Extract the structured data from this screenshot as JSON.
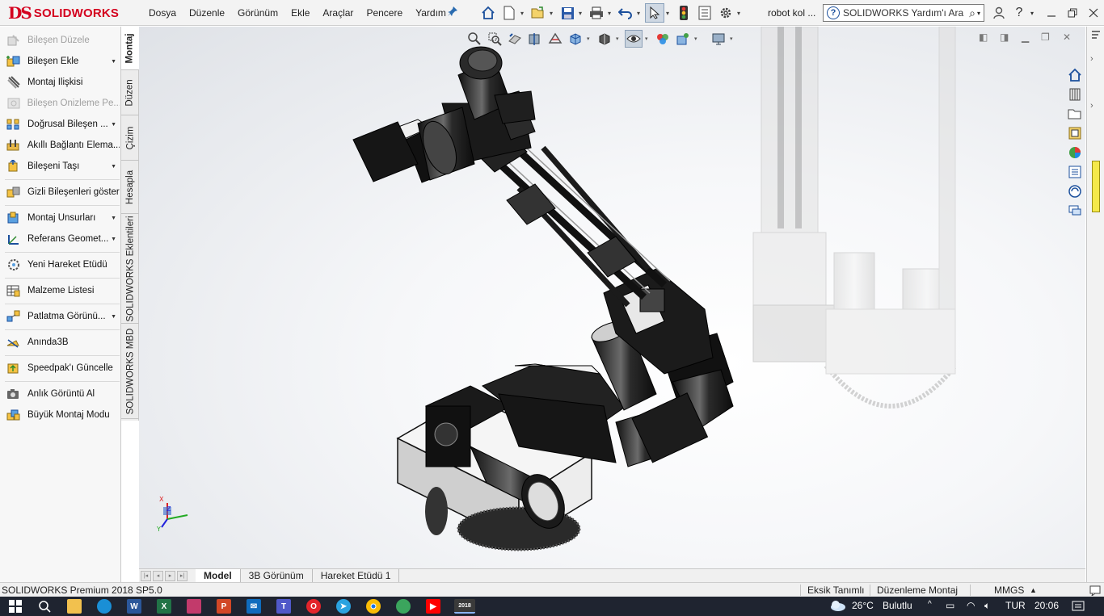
{
  "app": {
    "logo_ds": "DS",
    "logo_text": "SOLIDWORKS",
    "doc_title": "robot kol ..."
  },
  "menu": [
    "Dosya",
    "Düzenle",
    "Görünüm",
    "Ekle",
    "Araçlar",
    "Pencere",
    "Yardım"
  ],
  "search": {
    "placeholder": "SOLIDWORKS Yardım'ı Ara"
  },
  "commands": [
    {
      "label": "Bileşen Düzele",
      "disabled": true,
      "dropdown": false,
      "icon": "edit-component-icon"
    },
    {
      "label": "Bileşen Ekle",
      "disabled": false,
      "dropdown": true,
      "icon": "insert-component-icon"
    },
    {
      "label": "Montaj İlişkisi",
      "disabled": false,
      "dropdown": false,
      "icon": "mate-icon"
    },
    {
      "label": "Bileşen Önizleme Pe...",
      "disabled": true,
      "dropdown": false,
      "icon": "component-preview-icon"
    },
    {
      "label": "Doğrusal Bileşen ...",
      "disabled": false,
      "dropdown": true,
      "icon": "linear-pattern-icon"
    },
    {
      "label": "Akıllı Bağlantı Elema...",
      "disabled": false,
      "dropdown": false,
      "icon": "smart-fasteners-icon"
    },
    {
      "label": "Bileşeni Taşı",
      "disabled": false,
      "dropdown": true,
      "icon": "move-component-icon"
    },
    {
      "label": "Gizli Bileşenleri göster",
      "disabled": false,
      "dropdown": false,
      "icon": "show-hidden-icon"
    },
    {
      "label": "Montaj Unsurları",
      "disabled": false,
      "dropdown": true,
      "icon": "assembly-features-icon"
    },
    {
      "label": "Referans Geomet...",
      "disabled": false,
      "dropdown": true,
      "icon": "reference-geometry-icon"
    },
    {
      "label": "Yeni Hareket Etüdü",
      "disabled": false,
      "dropdown": false,
      "icon": "motion-study-icon"
    },
    {
      "label": "Malzeme Listesi",
      "disabled": false,
      "dropdown": false,
      "icon": "bill-of-materials-icon"
    },
    {
      "label": "Patlatma Görünü...",
      "disabled": false,
      "dropdown": true,
      "icon": "exploded-view-icon"
    },
    {
      "label": "Anında3B",
      "disabled": false,
      "dropdown": false,
      "icon": "instant3d-icon"
    },
    {
      "label": "Speedpak'ı Güncelle",
      "disabled": false,
      "dropdown": false,
      "icon": "speedpak-icon"
    },
    {
      "label": "Anlık Görüntü Al",
      "disabled": false,
      "dropdown": false,
      "icon": "snapshot-icon"
    },
    {
      "label": "Büyük Montaj Modu",
      "disabled": false,
      "dropdown": false,
      "icon": "large-assembly-icon"
    }
  ],
  "vtabs": [
    "Montaj",
    "Düzen",
    "Çizim",
    "Hesapla",
    "SOLIDWORKS Eklentileri",
    "SOLIDWORKS MBD"
  ],
  "bottom_tabs": [
    "Model",
    "3B Görünüm",
    "Hareket Etüdü 1"
  ],
  "triad": {
    "x": "X",
    "y": "Y",
    "z": "Z"
  },
  "status": {
    "product": "SOLIDWORKS Premium 2018 SP5.0",
    "definition": "Eksik Tanımlı",
    "mode": "Düzenleme Montaj",
    "units": "MMGS"
  },
  "taskbar": {
    "temp": "26°C",
    "weather": "Bulutlu",
    "lang": "TUR",
    "time": "20:06",
    "solidworks_badge": "2018"
  },
  "colors": {
    "brand_red": "#d4001e",
    "taskbar": "#1f2430",
    "accent_blue": "#1b4f9c"
  }
}
